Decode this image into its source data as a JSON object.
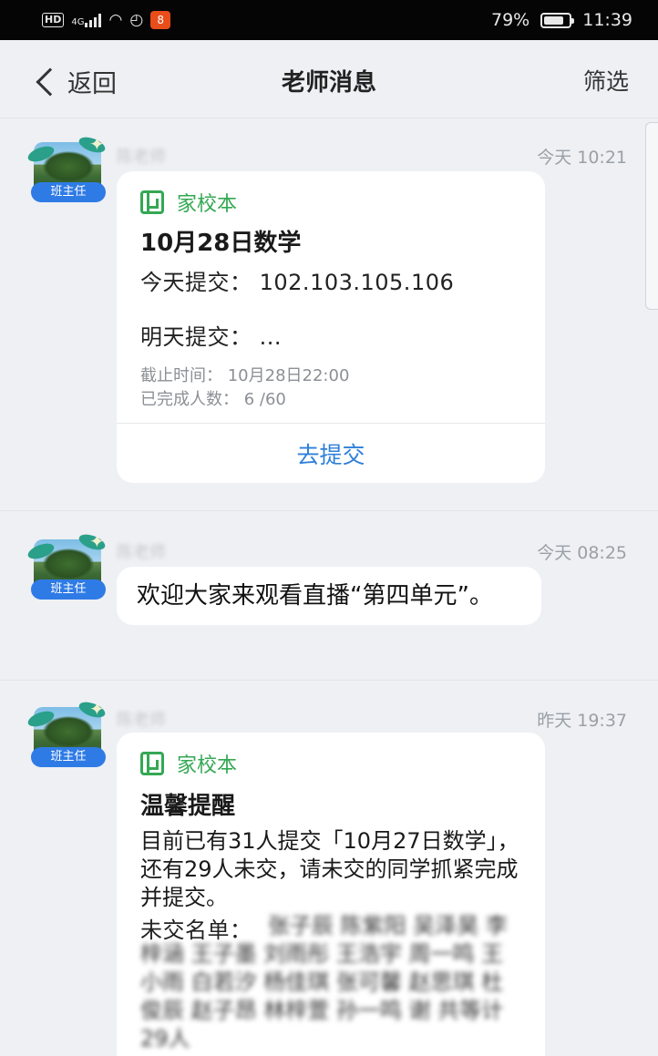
{
  "status_bar": {
    "hd": "HD",
    "network": "4G",
    "app_badge": "8",
    "battery": "79%",
    "battery_level": 0.79,
    "time": "11:39"
  },
  "nav": {
    "back_label": "返回",
    "title": "老师消息",
    "filter_label": "筛选"
  },
  "messages": [
    {
      "role": "班主任",
      "sender": "陈老师",
      "time": "今天 10:21",
      "card": {
        "source": "家校本",
        "title": "10月28日数学",
        "today_submit": "今天提交：  102.103.105.106",
        "tomorrow_submit": "明天提交：  ...",
        "deadline": "截止时间：  10月28日22:00",
        "completed": "已完成人数：  6 /60",
        "action": "去提交"
      }
    },
    {
      "role": "班主任",
      "sender": "陈老师",
      "time": "今天 08:25",
      "text": "欢迎大家来观看直播“第四单元”。"
    },
    {
      "role": "班主任",
      "sender": "陈老师",
      "time": "昨天 19:37",
      "card": {
        "source": "家校本",
        "title": "温馨提醒",
        "body": "目前已有31人提交「10月27日数学」，还有29人未交，请未交的同学抓紧完成并提交。",
        "unsubmitted_label": "未交名单：",
        "names": "张子辰 陈紫阳 吴泽昊 李梓涵 王子墨 刘雨彤 王浩宇 周一鸣 王小雨 白若汐 杨佳琪 张可馨 赵思琪 杜俊辰 赵子昂 林梓萱 孙一鸣 谢 共等计29人"
      }
    }
  ]
}
